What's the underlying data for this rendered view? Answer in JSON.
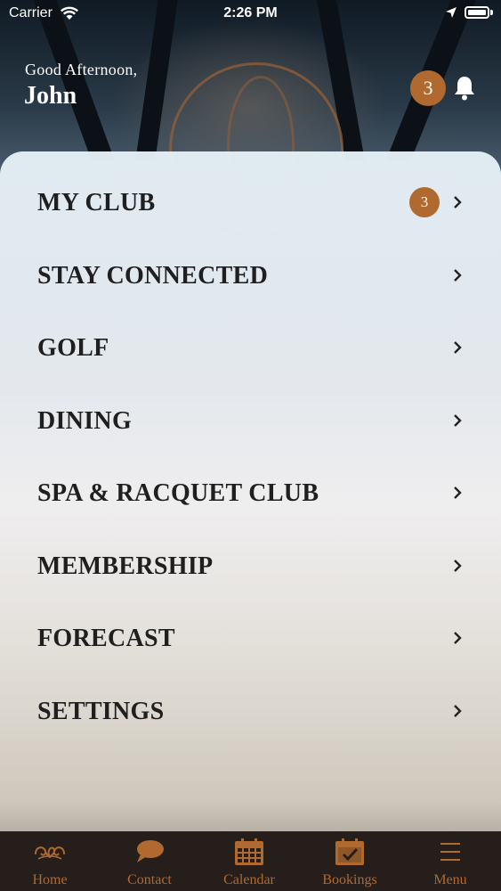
{
  "status_bar": {
    "carrier": "Carrier",
    "time": "2:26 PM"
  },
  "header": {
    "greeting": "Good Afternoon,",
    "name": "John",
    "notification_count": "3"
  },
  "menu": {
    "items": [
      {
        "label": "MY CLUB",
        "badge": "3"
      },
      {
        "label": "STAY CONNECTED"
      },
      {
        "label": "GOLF"
      },
      {
        "label": "DINING"
      },
      {
        "label": "SPA & RACQUET CLUB"
      },
      {
        "label": "MEMBERSHIP"
      },
      {
        "label": "FORECAST"
      },
      {
        "label": "SETTINGS"
      }
    ]
  },
  "tabbar": {
    "tabs": [
      {
        "label": "Home",
        "icon": "logo-flourish-icon"
      },
      {
        "label": "Contact",
        "icon": "chat-bubble-icon"
      },
      {
        "label": "Calendar",
        "icon": "calendar-icon"
      },
      {
        "label": "Bookings",
        "icon": "calendar-check-icon"
      },
      {
        "label": "Menu",
        "icon": "hamburger-menu-icon"
      }
    ]
  },
  "colors": {
    "accent": "#b06a2f",
    "tabbar_bg": "#251e1b",
    "menu_text": "#1f1f1f"
  }
}
